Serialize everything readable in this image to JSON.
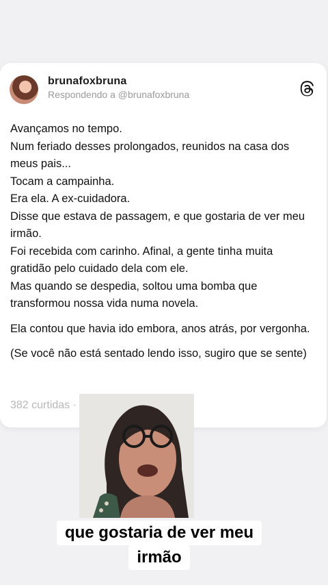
{
  "post": {
    "username": "brunafoxbruna",
    "reply_line": "Respondendo a @brunafoxbruna",
    "paragraphs": [
      "Avançamos no tempo.",
      "Num feriado desses prolongados, reunidos na casa dos meus pais...",
      "Tocam a campainha.",
      "Era ela. A ex-cuidadora.",
      "Disse que estava de passagem, e que gostaria de ver meu irmão.",
      "Foi recebida com carinho. Afinal, a gente tinha muita gratidão pelo cuidado dela com ele.",
      "Mas quando se despedia, soltou uma bomba que transformou nossa vida numa novela.",
      "Ela contou que havia ido embora, anos atrás, por vergonha.",
      "(Se você não está sentado lendo isso, sugiro que se sente)"
    ],
    "stats": "382 curtidas · 1 respos",
    "logo_icon": "threads-logo-icon"
  },
  "video": {
    "caption_line1": "que gostaria de ver meu",
    "caption_line2": "irmão"
  },
  "colors": {
    "background": "#f1f1f3",
    "card": "#ffffff",
    "text": "#111111",
    "muted": "#9a9a9a"
  }
}
